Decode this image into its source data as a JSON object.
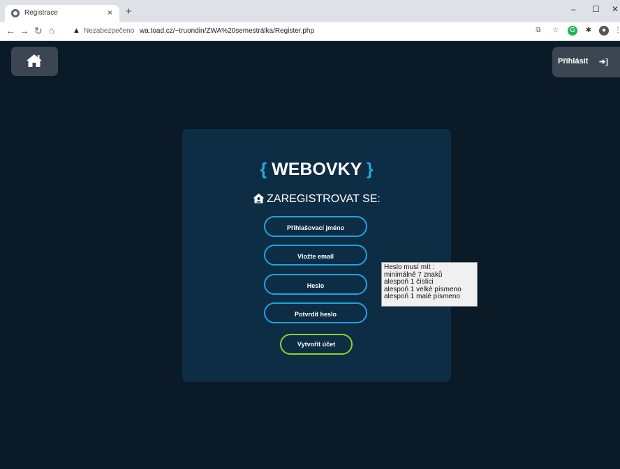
{
  "browser": {
    "tab_title": "Registrace",
    "tab_close": "×",
    "new_tab": "+",
    "security_label": "Nezabezpečeno",
    "url": "wa.toad.cz/~truondin/ZWA%20semestrálka/Register.php",
    "win_min": "–",
    "win_max": "☐",
    "win_close": "✕"
  },
  "header": {
    "home_icon": "home-icon",
    "login_label": "Přihlásit",
    "login_icon": "sign-in-icon"
  },
  "form": {
    "brand_open": "{",
    "brand_name": "WEBOVKY",
    "brand_close": "}",
    "title": "ZAREGISTROVAT SE:",
    "username_placeholder": "Přihlašovací jméno",
    "email_placeholder": "Vložte email",
    "password_placeholder": "Heslo",
    "confirm_placeholder": "Potvrdit heslo",
    "submit_label": "Vytvořit účet"
  },
  "tooltip": {
    "lines": [
      "Heslo musí mít :",
      "minimálně 7 znaků",
      "alespoň 1 číslici",
      "alespoň 1 velké písmeno",
      "alespoň 1 malé písmeno"
    ]
  },
  "colors": {
    "page_bg": "#0a1a26",
    "card_bg": "#0d2d45",
    "input_border": "#1fa3e0",
    "submit_border": "#8fd12b",
    "button_bg": "#3b4652"
  }
}
